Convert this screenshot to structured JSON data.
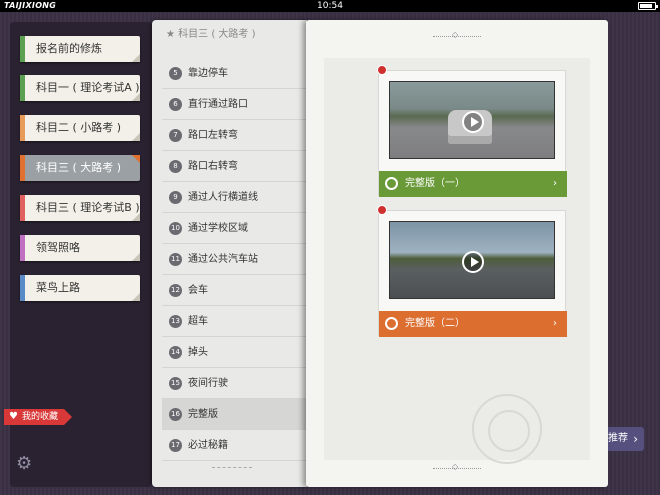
{
  "statusbar": {
    "brand": "TAIJIXIONG",
    "time": "10:54"
  },
  "sidebar": {
    "items": [
      {
        "label": "报名前的修炼",
        "color": "#5aa050"
      },
      {
        "label": "科目一 ( 理论考试A )",
        "color": "#5aa050"
      },
      {
        "label": "科目二 ( 小路考 )",
        "color": "#e89a58"
      },
      {
        "label": "科目三 ( 大路考 )",
        "color": "#e07030",
        "active": true
      },
      {
        "label": "科目三 ( 理论考试B )",
        "color": "#e06060"
      },
      {
        "label": "领驾照咯",
        "color": "#c070c0"
      },
      {
        "label": "菜鸟上路",
        "color": "#5b8ac8"
      }
    ],
    "favorite_label": "我的收藏",
    "favorite_icon": "heart-icon",
    "settings_icon": "gear-icon"
  },
  "list": {
    "header": "★ 科目三 ( 大路考 )",
    "rows": [
      {
        "num": "5",
        "label": "靠边停车"
      },
      {
        "num": "6",
        "label": "直行通过路口"
      },
      {
        "num": "7",
        "label": "路口左转弯"
      },
      {
        "num": "8",
        "label": "路口右转弯"
      },
      {
        "num": "9",
        "label": "通过人行横道线"
      },
      {
        "num": "10",
        "label": "通过学校区域"
      },
      {
        "num": "11",
        "label": "通过公共汽车站"
      },
      {
        "num": "12",
        "label": "会车"
      },
      {
        "num": "13",
        "label": "超车"
      },
      {
        "num": "14",
        "label": "掉头"
      },
      {
        "num": "15",
        "label": "夜间行驶"
      },
      {
        "num": "16",
        "label": "完整版",
        "selected": true
      },
      {
        "num": "17",
        "label": "必过秘籍"
      }
    ]
  },
  "detail": {
    "videos": [
      {
        "label": "完整版（一）",
        "bar_color": "#6a9a38"
      },
      {
        "label": "完整版（二）",
        "bar_color": "#dc6e30"
      }
    ]
  },
  "recommend_button": {
    "label": "推荐"
  }
}
